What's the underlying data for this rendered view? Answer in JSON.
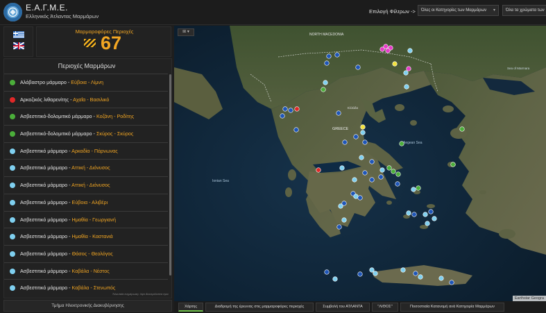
{
  "header": {
    "title": "Ε.Α.Γ.Μ.Ε.",
    "subtitle": "Ελληνικός Άτλαντας Μαρμάρων",
    "filter_label": "Επιλογή Φίλτρων ->",
    "filter_category": "Όλες οι Κατηγορίες των Μαρμάρων",
    "filter_color": "Όλα τα χρώματα των"
  },
  "counter": {
    "label": "Μαρμαροφόρες Περιοχές",
    "value": "67"
  },
  "list": {
    "title": "Περιοχές Μαρμάρων",
    "note": "Τελευταία ενημέρωση: λίγα δευτερόλεπτα πριν",
    "items": [
      {
        "type": "Αλάβαστρο μάρμαρο",
        "location": "Εύβοια - Λίμνη",
        "color": "#4bae3a"
      },
      {
        "type": "Αρκοζικός λιθαρενίτης",
        "location": "Αχαΐα - Βασιλικό",
        "color": "#e02828"
      },
      {
        "type": "Ασβεστιτικό-δολομιτικό μάρμαρο",
        "location": "Κοζάνη - Ροδίτης",
        "color": "#4bae3a"
      },
      {
        "type": "Ασβεστιτικό-δολομιτικό μάρμαρο",
        "location": "Σκύρος - Σκύρος",
        "color": "#4bae3a"
      },
      {
        "type": "Ασβεστιτικό μάρμαρο",
        "location": "Αρκαδία - Πάρνωνας",
        "color": "#7fd0f0"
      },
      {
        "type": "Ασβεστιτικό μάρμαρο",
        "location": "Αττική - Διόνυσος",
        "color": "#7fd0f0"
      },
      {
        "type": "Ασβεστιτικό μάρμαρο",
        "location": "Αττική - Διόνυσος",
        "color": "#7fd0f0"
      },
      {
        "type": "Ασβεστιτικό μάρμαρο",
        "location": "Εύβοια - Αλιβέρι",
        "color": "#7fd0f0"
      },
      {
        "type": "Ασβεστιτικό μάρμαρο",
        "location": "Ημαθία - Γεωργιανή",
        "color": "#7fd0f0"
      },
      {
        "type": "Ασβεστιτικό μάρμαρο",
        "location": "Ημαθία - Καστανιά",
        "color": "#7fd0f0"
      },
      {
        "type": "Ασβεστιτικό μάρμαρο",
        "location": "Θάσος - Θεολόγος",
        "color": "#7fd0f0"
      },
      {
        "type": "Ασβεστιτικό μάρμαρο",
        "location": "Καβάλα - Νέστος",
        "color": "#7fd0f0"
      },
      {
        "type": "Ασβεστιτικό μάρμαρο",
        "location": "Καβάλα - Στενωπός",
        "color": "#7fd0f0"
      }
    ]
  },
  "footer": {
    "department": "Τμήμα Ηλεκτρονικής Διακυβέρνησης"
  },
  "map": {
    "tool_icon": "map-tool-icon",
    "labels": [
      {
        "text": "NORTH MACEDONIA"
      },
      {
        "text": "GREECE"
      },
      {
        "text": "Ionian Sea"
      },
      {
        "text": "Sea of Marmara"
      },
      {
        "text": "Aegean Sea"
      },
      {
        "text": "Ελλάδα"
      }
    ],
    "attribution": "Earthstar Geogra"
  },
  "tabs": [
    {
      "label": "Χάρτης",
      "active": true
    },
    {
      "label": "Διαδρομή της έρευνας στις μαρμαροφόρες περιοχές",
      "active": false
    },
    {
      "label": "Συμβολή του ΑΤΛΑΝΤΑ",
      "active": false
    },
    {
      "label": "\"ΛΙΘΟΣ\"",
      "active": false
    },
    {
      "label": "Ποσοστιαία Κατανομή ανά Κατηγορία Μαρμάρων",
      "active": false
    }
  ]
}
